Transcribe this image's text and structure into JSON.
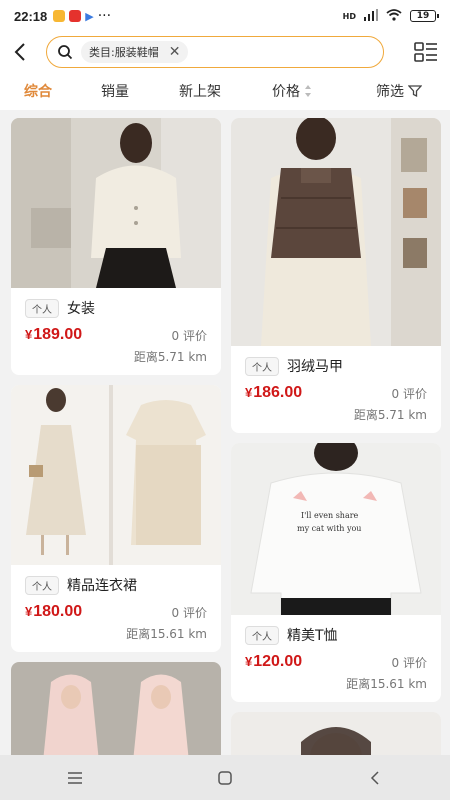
{
  "status_bar": {
    "time": "22:18",
    "battery": "19",
    "network": "HD"
  },
  "search": {
    "chip_label": "类目:服装鞋帽"
  },
  "tabs": [
    {
      "label": "综合",
      "active": true
    },
    {
      "label": "销量"
    },
    {
      "label": "新上架"
    },
    {
      "label": "价格"
    },
    {
      "label": "筛选"
    }
  ],
  "products": {
    "left": [
      {
        "tag": "个人",
        "name": "女装",
        "price": "189.00",
        "reviews": "0 评价",
        "distance": "距离5.71 km"
      },
      {
        "tag": "个人",
        "name": "精品连衣裙",
        "price": "180.00",
        "reviews": "0 评价",
        "distance": "距离15.61 km"
      }
    ],
    "right": [
      {
        "tag": "个人",
        "name": "羽绒马甲",
        "price": "186.00",
        "reviews": "0 评价",
        "distance": "距离5.71 km"
      },
      {
        "tag": "个人",
        "name": "精美T恤",
        "price": "120.00",
        "reviews": "0 评价",
        "distance": "距离15.61 km"
      }
    ]
  },
  "currency": "¥",
  "colors": {
    "accent": "#e0893a",
    "price": "#d01818",
    "search_border": "#f0a93c"
  }
}
